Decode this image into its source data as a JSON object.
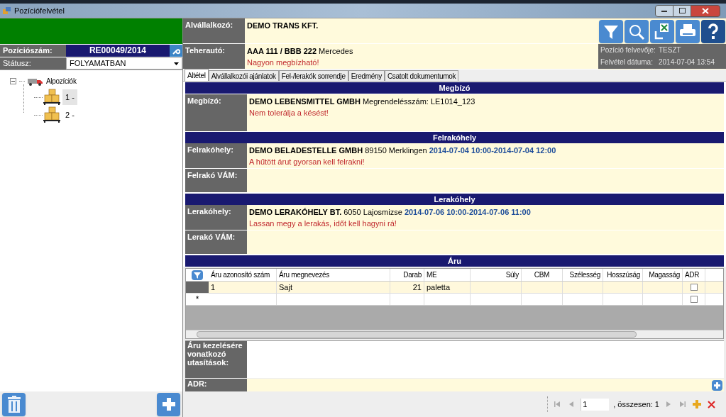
{
  "window": {
    "title": "Pozíciófelvétel"
  },
  "left": {
    "position_label": "Pozíciószám:",
    "position_value": "RE00049/2014",
    "status_label": "Státusz:",
    "status_value": "FOLYAMATBAN",
    "tree": {
      "label": "Alpozíciók",
      "expanded": true,
      "children": [
        {
          "label": "1 -",
          "selected": true
        },
        {
          "label": "2 -",
          "selected": false
        }
      ]
    }
  },
  "header": [
    {
      "label": "Alvállalkozó:",
      "lines": [
        [
          {
            "kind": "strong",
            "text": "DEMO TRANS KFT."
          }
        ]
      ]
    },
    {
      "label": "Teherautó:",
      "lines": [
        [
          {
            "kind": "strong",
            "text": "AAA 111 / BBB 222"
          },
          {
            "kind": "plain",
            "text": "Mercedes"
          }
        ],
        [
          {
            "kind": "warning",
            "text": "Nagyon megbízható!"
          }
        ]
      ]
    }
  ],
  "info": [
    {
      "label": "Pozíció felvevője:",
      "value": "TESZT"
    },
    {
      "label": "Felvétel dátuma:",
      "value": "2014-07-04 13:54"
    }
  ],
  "tabs": [
    {
      "label": "Altétel",
      "selected": true
    },
    {
      "label": "Alvállalkozói ajánlatok",
      "selected": false
    },
    {
      "label": "Fel-/lerakók sorrendje",
      "selected": false
    },
    {
      "label": "Eredmény",
      "selected": false
    },
    {
      "label": "Csatolt dokumentumok",
      "selected": false
    }
  ],
  "sections": [
    {
      "title": "Megbízó",
      "rows": [
        {
          "label": "Megbízó:",
          "lines": [
            [
              {
                "kind": "strong",
                "text": "DEMO LEBENSMITTEL GMBH"
              },
              {
                "kind": "plain",
                "text": "Megrendelésszám: LE1014_123"
              }
            ],
            [
              {
                "kind": "warning",
                "text": "Nem tolerálja a késést!"
              }
            ]
          ]
        }
      ]
    },
    {
      "title": "Felrakóhely",
      "rows": [
        {
          "label": "Felrakóhely:",
          "lines": [
            [
              {
                "kind": "strong",
                "text": "DEMO BELADESTELLE GMBH"
              },
              {
                "kind": "plain",
                "text": "89150 Merklingen"
              },
              {
                "kind": "date",
                "text": "2014-07-04 10:00-2014-07-04 12:00"
              }
            ],
            [
              {
                "kind": "warning",
                "text": "A hűtött árut gyorsan kell felrakni!"
              }
            ]
          ]
        },
        {
          "label": "Felrakó VÁM:"
        }
      ]
    },
    {
      "title": "Lerakóhely",
      "rows": [
        {
          "label": "Lerakóhely:",
          "lines": [
            [
              {
                "kind": "strong",
                "text": "DEMO LERAKÓHELY BT."
              },
              {
                "kind": "plain",
                "text": "6050 Lajosmizse"
              },
              {
                "kind": "date",
                "text": "2014-07-06 10:00-2014-07-06 11:00"
              }
            ],
            [
              {
                "kind": "warning",
                "text": "Lassan megy a lerakás, időt kell hagyni rá!"
              }
            ]
          ]
        },
        {
          "label": "Lerakó VÁM:"
        }
      ]
    },
    {
      "title": "Áru"
    }
  ],
  "goods_table": {
    "columns": [
      {
        "label": "Áru azonosító szám"
      },
      {
        "label": "Áru megnevezés"
      },
      {
        "label": "Darab"
      },
      {
        "label": "ME"
      },
      {
        "label": "Súly"
      },
      {
        "label": "CBM"
      },
      {
        "label": "Szélesség"
      },
      {
        "label": "Hosszúság"
      },
      {
        "label": "Magasság"
      },
      {
        "label": "ADR"
      }
    ],
    "rows": [
      {
        "cells": [
          "1",
          "Sajt",
          "21",
          "paletta",
          "",
          "",
          "",
          "",
          ""
        ],
        "adr": false
      }
    ],
    "new_row": {
      "marker": "*",
      "adr": false
    }
  },
  "instructions_label": "Áru kezelésére vonatkozó utasítások:",
  "adr_label": "ADR:",
  "pager": {
    "page": "1",
    "total": ", összesen: 1"
  }
}
